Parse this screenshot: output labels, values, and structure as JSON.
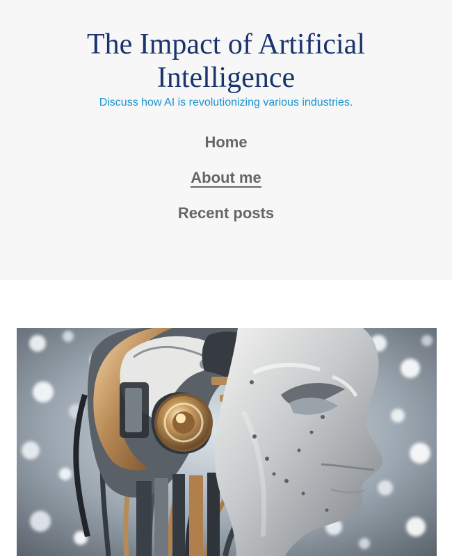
{
  "site": {
    "title": "The Impact of Artificial Intelligence",
    "tagline": "Discuss how AI is revolutionizing various industries."
  },
  "navigation": {
    "items": [
      {
        "label": "Home"
      },
      {
        "label": "About me"
      },
      {
        "label": "Recent posts"
      }
    ]
  },
  "colors": {
    "header_background": "#f7f7f7",
    "title": "#19336f",
    "tagline": "#1a93cd",
    "navigation_text": "#666666"
  }
}
